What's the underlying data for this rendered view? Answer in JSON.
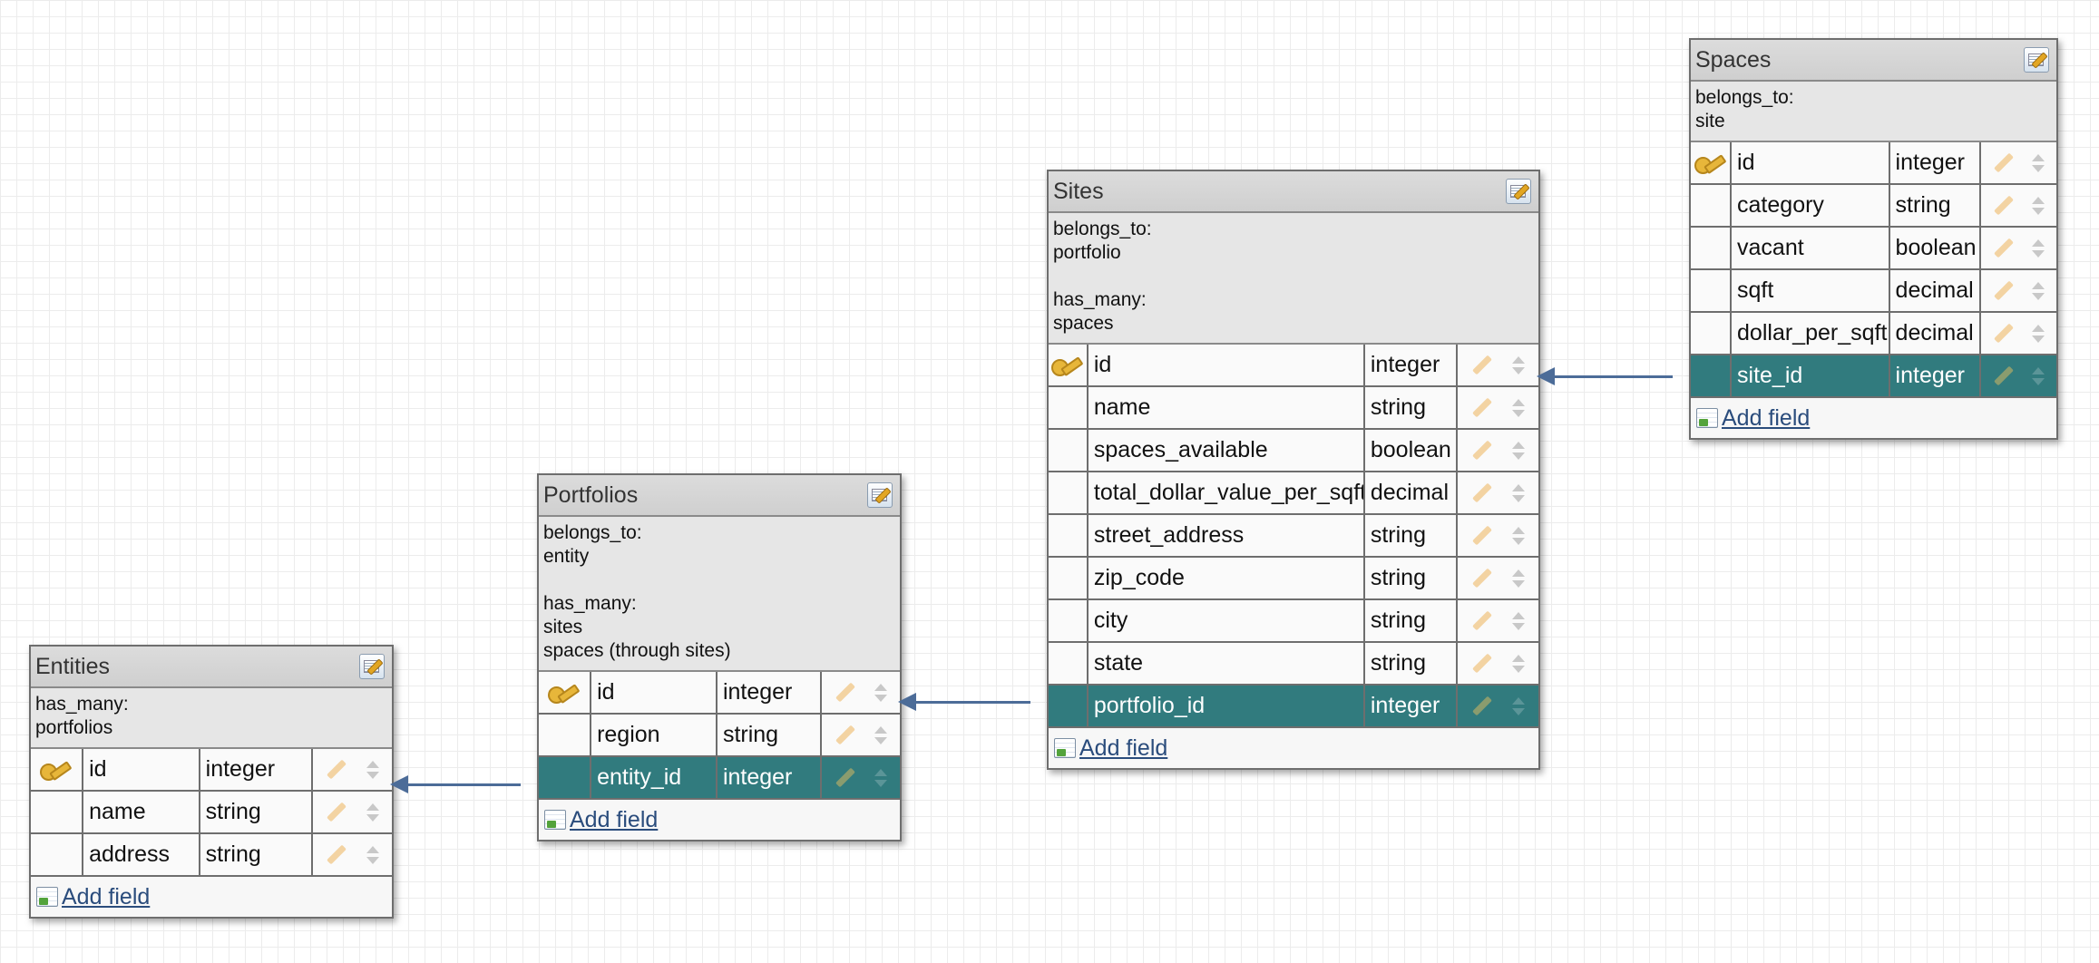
{
  "colors": {
    "fk_row": "#317b7e",
    "connector": "#4c6c98",
    "link": "#2a4c7c"
  },
  "common": {
    "add_field": "Add field"
  },
  "tables": {
    "entities": {
      "title": "Entities",
      "assoc": [
        {
          "label": "has_many:",
          "items": [
            "portfolios"
          ]
        }
      ],
      "fields": [
        {
          "name": "id",
          "type": "integer",
          "pk": true,
          "fk": false
        },
        {
          "name": "name",
          "type": "string",
          "pk": false,
          "fk": false
        },
        {
          "name": "address",
          "type": "string",
          "pk": false,
          "fk": false
        }
      ]
    },
    "portfolios": {
      "title": "Portfolios",
      "assoc": [
        {
          "label": "belongs_to:",
          "items": [
            "entity"
          ]
        },
        {
          "label": "has_many:",
          "items": [
            "sites",
            "spaces (through sites)"
          ]
        }
      ],
      "fields": [
        {
          "name": "id",
          "type": "integer",
          "pk": true,
          "fk": false
        },
        {
          "name": "region",
          "type": "string",
          "pk": false,
          "fk": false
        },
        {
          "name": "entity_id",
          "type": "integer",
          "pk": false,
          "fk": true
        }
      ]
    },
    "sites": {
      "title": "Sites",
      "assoc": [
        {
          "label": "belongs_to:",
          "items": [
            "portfolio"
          ]
        },
        {
          "label": "has_many:",
          "items": [
            "spaces"
          ]
        }
      ],
      "fields": [
        {
          "name": "id",
          "type": "integer",
          "pk": true,
          "fk": false
        },
        {
          "name": "name",
          "type": "string",
          "pk": false,
          "fk": false
        },
        {
          "name": "spaces_available",
          "type": "boolean",
          "pk": false,
          "fk": false
        },
        {
          "name": "total_dollar_value_per_sqft",
          "type": "decimal",
          "pk": false,
          "fk": false
        },
        {
          "name": "street_address",
          "type": "string",
          "pk": false,
          "fk": false
        },
        {
          "name": "zip_code",
          "type": "string",
          "pk": false,
          "fk": false
        },
        {
          "name": "city",
          "type": "string",
          "pk": false,
          "fk": false
        },
        {
          "name": "state",
          "type": "string",
          "pk": false,
          "fk": false
        },
        {
          "name": "portfolio_id",
          "type": "integer",
          "pk": false,
          "fk": true
        }
      ]
    },
    "spaces": {
      "title": "Spaces",
      "assoc": [
        {
          "label": "belongs_to:",
          "items": [
            "site"
          ]
        }
      ],
      "fields": [
        {
          "name": "id",
          "type": "integer",
          "pk": true,
          "fk": false
        },
        {
          "name": "category",
          "type": "string",
          "pk": false,
          "fk": false
        },
        {
          "name": "vacant",
          "type": "boolean",
          "pk": false,
          "fk": false
        },
        {
          "name": "sqft",
          "type": "decimal",
          "pk": false,
          "fk": false
        },
        {
          "name": "dollar_per_sqft",
          "type": "decimal",
          "pk": false,
          "fk": false
        },
        {
          "name": "site_id",
          "type": "integer",
          "pk": false,
          "fk": true
        }
      ]
    }
  }
}
